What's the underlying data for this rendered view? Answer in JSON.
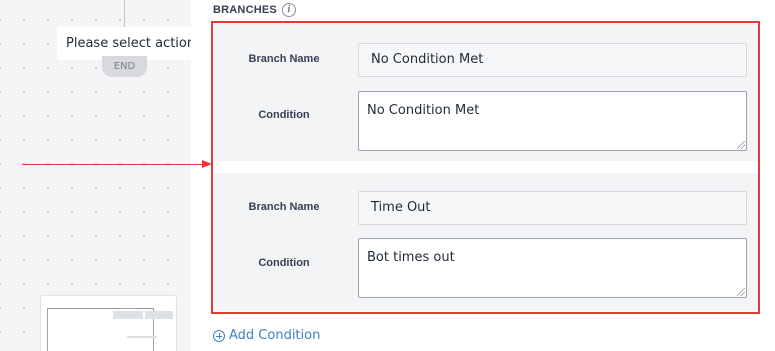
{
  "canvas": {
    "action_node_label": "Please select action",
    "end_node_label": "END"
  },
  "branches_section": {
    "title": "BRANCHES",
    "info_icon": "i",
    "highlight_color": "#e53935",
    "branches": [
      {
        "branch_name_label": "Branch Name",
        "branch_name_value": "No Condition Met",
        "condition_label": "Condition",
        "condition_value": "No Condition Met"
      },
      {
        "branch_name_label": "Branch Name",
        "branch_name_value": "Time Out",
        "condition_label": "Condition",
        "condition_value": "Bot times out"
      }
    ],
    "add_condition_label": "Add Condition"
  },
  "colors": {
    "accent_link": "#3b82c4",
    "highlight": "#e53935"
  }
}
